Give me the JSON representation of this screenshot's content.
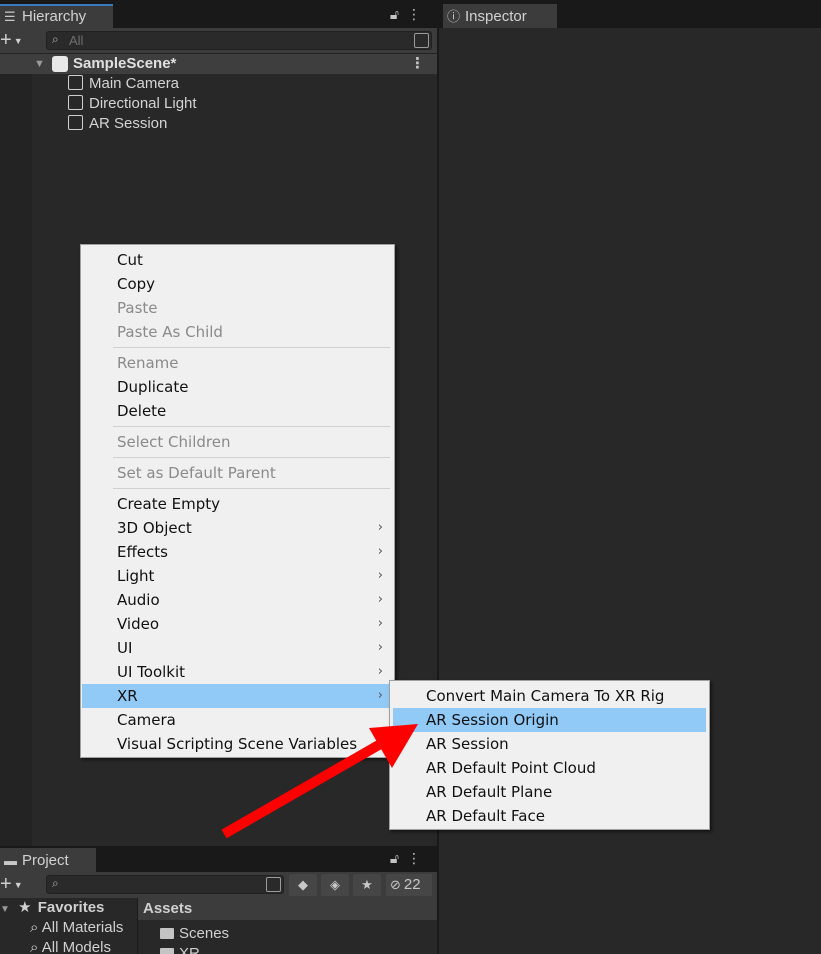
{
  "hierarchy": {
    "tab_label": "Hierarchy",
    "search_placeholder": "All",
    "scene_name": "SampleScene*",
    "items": [
      {
        "label": "Main Camera"
      },
      {
        "label": "Directional Light"
      },
      {
        "label": "AR Session"
      }
    ]
  },
  "inspector": {
    "tab_label": "Inspector"
  },
  "context_menu": {
    "items": [
      {
        "label": "Cut",
        "enabled": true
      },
      {
        "label": "Copy",
        "enabled": true
      },
      {
        "label": "Paste",
        "enabled": false
      },
      {
        "label": "Paste As Child",
        "enabled": false
      },
      {
        "label": "Rename",
        "enabled": false
      },
      {
        "label": "Duplicate",
        "enabled": true
      },
      {
        "label": "Delete",
        "enabled": true
      },
      {
        "label": "Select Children",
        "enabled": false
      },
      {
        "label": "Set as Default Parent",
        "enabled": false
      },
      {
        "label": "Create Empty",
        "enabled": true
      },
      {
        "label": "3D Object",
        "enabled": true,
        "submenu": true
      },
      {
        "label": "Effects",
        "enabled": true,
        "submenu": true
      },
      {
        "label": "Light",
        "enabled": true,
        "submenu": true
      },
      {
        "label": "Audio",
        "enabled": true,
        "submenu": true
      },
      {
        "label": "Video",
        "enabled": true,
        "submenu": true
      },
      {
        "label": "UI",
        "enabled": true,
        "submenu": true
      },
      {
        "label": "UI Toolkit",
        "enabled": true,
        "submenu": true
      },
      {
        "label": "XR",
        "enabled": true,
        "submenu": true,
        "highlighted": true
      },
      {
        "label": "Camera",
        "enabled": true
      },
      {
        "label": "Visual Scripting Scene Variables",
        "enabled": true
      }
    ]
  },
  "xr_submenu": {
    "items": [
      {
        "label": "Convert Main Camera To XR Rig"
      },
      {
        "label": "AR Session Origin",
        "highlighted": true
      },
      {
        "label": "AR Session"
      },
      {
        "label": "AR Default Point Cloud"
      },
      {
        "label": "AR Default Plane"
      },
      {
        "label": "AR Default Face"
      }
    ]
  },
  "project": {
    "tab_label": "Project",
    "hidden_count": "22",
    "favorites_label": "Favorites",
    "favorites": [
      "All Materials",
      "All Models"
    ],
    "assets_header": "Assets",
    "assets": [
      "Scenes",
      "XR"
    ]
  },
  "colors": {
    "menu_highlight": "#91c9f7",
    "annotation_arrow": "#ff0000",
    "panel_bg": "#282828"
  }
}
